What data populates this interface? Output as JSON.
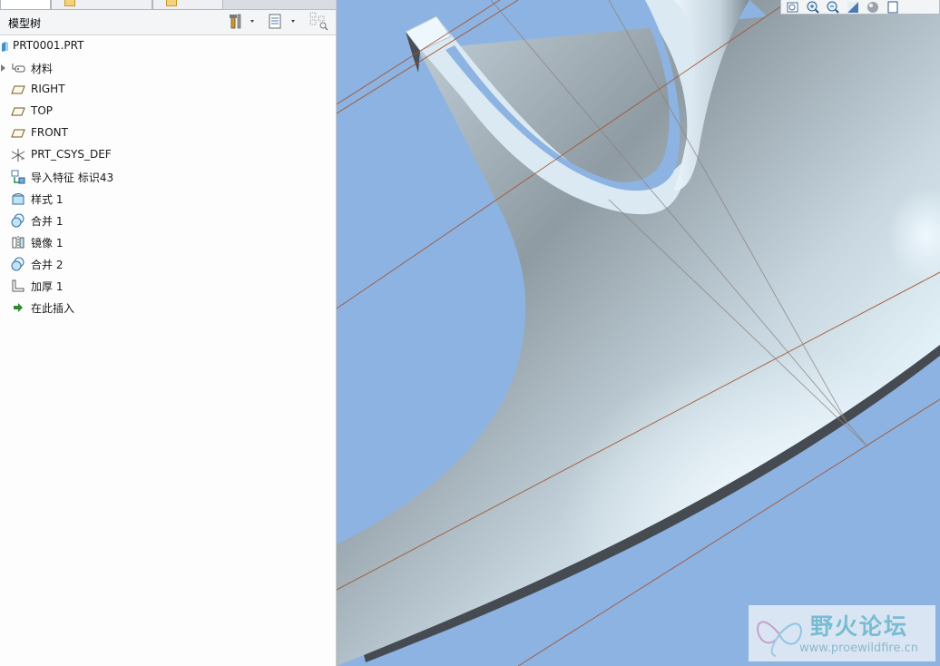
{
  "panel": {
    "title": "模型树"
  },
  "tree": [
    {
      "label": "PRT0001.PRT",
      "icon": "part-icon"
    },
    {
      "label": "材料",
      "icon": "material-icon",
      "expandable": true
    },
    {
      "label": "RIGHT",
      "icon": "datum-plane-icon"
    },
    {
      "label": "TOP",
      "icon": "datum-plane-icon"
    },
    {
      "label": "FRONT",
      "icon": "datum-plane-icon"
    },
    {
      "label": "PRT_CSYS_DEF",
      "icon": "csys-icon"
    },
    {
      "label": "导入特征 标识43",
      "icon": "import-feature-icon"
    },
    {
      "label": "样式 1",
      "icon": "style-icon"
    },
    {
      "label": "合并 1",
      "icon": "merge-icon"
    },
    {
      "label": "镜像 1",
      "icon": "mirror-icon"
    },
    {
      "label": "合并 2",
      "icon": "merge-icon"
    },
    {
      "label": "加厚 1",
      "icon": "thicken-icon"
    },
    {
      "label": "在此插入",
      "icon": "insert-here-arrow-icon"
    }
  ],
  "colors": {
    "background": "#8db3e2",
    "surface_light": "#eaf6fd",
    "surface_dark": "#4a4f57",
    "datum_line": "#a0522d"
  },
  "watermark": {
    "title": "野火论坛",
    "url": "www.proewildfire.cn"
  }
}
